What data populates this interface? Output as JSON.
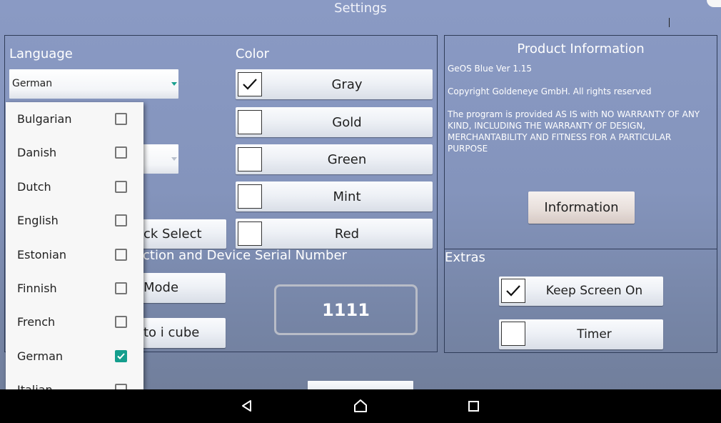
{
  "header": {
    "title": "Settings"
  },
  "language": {
    "section_label": "Language",
    "selected": "German",
    "options": [
      {
        "label": "Bulgarian",
        "checked": false
      },
      {
        "label": "Danish",
        "checked": false
      },
      {
        "label": "Dutch",
        "checked": false
      },
      {
        "label": "English",
        "checked": false
      },
      {
        "label": "Estonian",
        "checked": false
      },
      {
        "label": "Finnish",
        "checked": false
      },
      {
        "label": "French",
        "checked": false
      },
      {
        "label": "German",
        "checked": true
      },
      {
        "label": "Italian",
        "checked": false
      }
    ]
  },
  "hidden_left": {
    "quick_select_label": "ck Select",
    "section_label": "ction and Device Serial Number",
    "mode_label": "Mode",
    "cube_label": "to i cube"
  },
  "color": {
    "section_label": "Color",
    "options": [
      {
        "label": "Gray",
        "checked": true
      },
      {
        "label": "Gold",
        "checked": false
      },
      {
        "label": "Green",
        "checked": false
      },
      {
        "label": "Mint",
        "checked": false
      },
      {
        "label": "Red",
        "checked": false
      }
    ]
  },
  "serial": {
    "value": "1111"
  },
  "product": {
    "title": "Product Information",
    "version": "GeOS Blue Ver 1.15",
    "copyright": "Copyright Goldeneye GmbH. All rights reserved",
    "disclaimer": "The program is provided AS IS with NO WARRANTY OF ANY KIND, INCLUDING THE WARRANTY OF DESIGN, MERCHANTABILITY AND FITNESS FOR A PARTICULAR PURPOSE",
    "info_button": "Information"
  },
  "extras": {
    "section_label": "Extras",
    "keep_screen_on": {
      "label": "Keep Screen On",
      "checked": true
    },
    "timer": {
      "label": "Timer",
      "checked": false
    }
  },
  "colors": {
    "accent_checkbox": "#149e8d",
    "background": "#8494bc",
    "navbar": "#000000"
  },
  "navbar": {
    "icons": [
      "back-icon",
      "home-icon",
      "recents-icon"
    ]
  }
}
